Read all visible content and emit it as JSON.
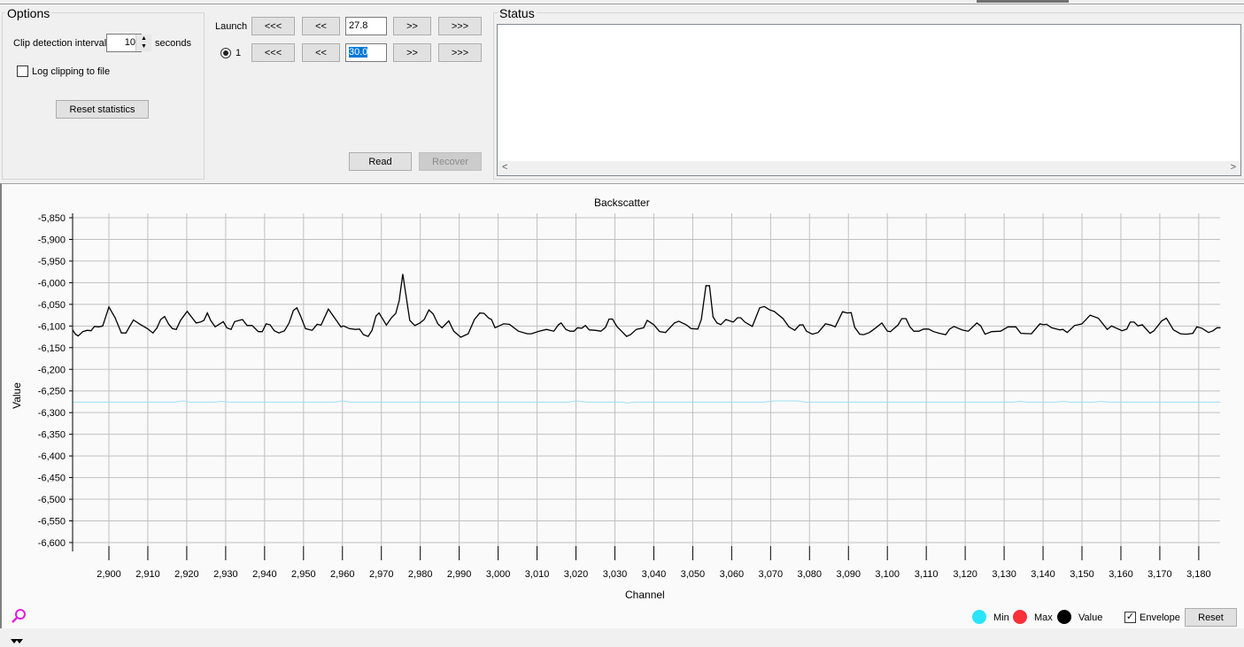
{
  "options": {
    "title": "Options",
    "clip_label": "Clip detection interval",
    "clip_value": "10",
    "clip_unit": "seconds",
    "log_label": "Log clipping to file",
    "log_checked": false,
    "reset_stats": "Reset statistics"
  },
  "nav": {
    "launch_label": "Launch",
    "radio_label": "1",
    "btn_fast_back": "<<<",
    "btn_back": "<<",
    "btn_fwd": ">>",
    "btn_fast_fwd": ">>>",
    "launch_value": "27.8",
    "row2_value": "30.0",
    "read": "Read",
    "recover": "Recover"
  },
  "status": {
    "title": "Status",
    "scroll_left": "<",
    "scroll_right": ">"
  },
  "legend": {
    "min": "Min",
    "max": "Max",
    "value": "Value",
    "envelope": "Envelope",
    "reset": "Reset",
    "colors": {
      "min": "#29e4fb",
      "max": "#fb3039",
      "value": "#000000"
    }
  },
  "chart_data": {
    "type": "line",
    "title": "Backscatter",
    "xlabel": "Channel",
    "ylabel": "Value",
    "xlim": [
      2890.7,
      3185.6
    ],
    "ylim": [
      -6600,
      -5850
    ],
    "grid": true,
    "xticks": [
      "2,900",
      "2,910",
      "2,920",
      "2,930",
      "2,940",
      "2,950",
      "2,960",
      "2,970",
      "2,980",
      "2,990",
      "3,000",
      "3,010",
      "3,020",
      "3,030",
      "3,040",
      "3,050",
      "3,060",
      "3,070",
      "3,080",
      "3,090",
      "3,100",
      "3,110",
      "3,120",
      "3,130",
      "3,140",
      "3,150",
      "3,160",
      "3,170",
      "3,180"
    ],
    "xtick_values": [
      2900,
      2910,
      2920,
      2930,
      2940,
      2950,
      2960,
      2970,
      2980,
      2990,
      3000,
      3010,
      3020,
      3030,
      3040,
      3050,
      3060,
      3070,
      3080,
      3090,
      3100,
      3110,
      3120,
      3130,
      3140,
      3150,
      3160,
      3170,
      3180
    ],
    "yticks": [
      "-5,850",
      "-5,900",
      "-5,950",
      "-6,000",
      "-6,050",
      "-6,100",
      "-6,150",
      "-6,200",
      "-6,250",
      "-6,300",
      "-6,350",
      "-6,400",
      "-6,450",
      "-6,500",
      "-6,550",
      "-6,600"
    ],
    "ytick_values": [
      -5850,
      -5900,
      -5950,
      -6000,
      -6050,
      -6100,
      -6150,
      -6200,
      -6250,
      -6300,
      -6350,
      -6400,
      -6450,
      -6500,
      -6550,
      -6600
    ],
    "series": [
      {
        "name": "Value",
        "color": "#000000",
        "points": [
          [
            2890.7,
            -6109
          ],
          [
            2891.4,
            -6119
          ],
          [
            2892.1,
            -6123
          ],
          [
            2893.3,
            -6113
          ],
          [
            2894.4,
            -6110
          ],
          [
            2895.4,
            -6111
          ],
          [
            2896.3,
            -6101
          ],
          [
            2897.4,
            -6102
          ],
          [
            2898.4,
            -6100
          ],
          [
            2900,
            -6056
          ],
          [
            2901.6,
            -6081
          ],
          [
            2903.2,
            -6116
          ],
          [
            2904.4,
            -6116
          ],
          [
            2905.4,
            -6100
          ],
          [
            2906.3,
            -6086
          ],
          [
            2908,
            -6096
          ],
          [
            2909.9,
            -6106
          ],
          [
            2911.3,
            -6116
          ],
          [
            2912.3,
            -6105
          ],
          [
            2913.3,
            -6085
          ],
          [
            2914.3,
            -6078
          ],
          [
            2915.3,
            -6095
          ],
          [
            2916.3,
            -6106
          ],
          [
            2917.3,
            -6108
          ],
          [
            2918.4,
            -6087
          ],
          [
            2920.1,
            -6066
          ],
          [
            2922.4,
            -6093
          ],
          [
            2923.5,
            -6091
          ],
          [
            2924.4,
            -6087
          ],
          [
            2925.3,
            -6070
          ],
          [
            2926.2,
            -6088
          ],
          [
            2927.3,
            -6102
          ],
          [
            2929.4,
            -6090
          ],
          [
            2930.3,
            -6104
          ],
          [
            2931.4,
            -6108
          ],
          [
            2932.3,
            -6090
          ],
          [
            2934.3,
            -6085
          ],
          [
            2935.5,
            -6099
          ],
          [
            2936.8,
            -6099
          ],
          [
            2938.4,
            -6113
          ],
          [
            2939.4,
            -6113
          ],
          [
            2940.4,
            -6095
          ],
          [
            2941.4,
            -6097
          ],
          [
            2942.5,
            -6111
          ],
          [
            2943.7,
            -6116
          ],
          [
            2945.1,
            -6111
          ],
          [
            2946.3,
            -6093
          ],
          [
            2947.4,
            -6064
          ],
          [
            2948.3,
            -6058
          ],
          [
            2949.3,
            -6078
          ],
          [
            2950.5,
            -6106
          ],
          [
            2952.2,
            -6110
          ],
          [
            2953.5,
            -6096
          ],
          [
            2954.5,
            -6098
          ],
          [
            2956.4,
            -6061
          ],
          [
            2959.6,
            -6102
          ],
          [
            2960.3,
            -6100
          ],
          [
            2961.8,
            -6106
          ],
          [
            2963.3,
            -6108
          ],
          [
            2964.4,
            -6107
          ],
          [
            2965.4,
            -6120
          ],
          [
            2966.6,
            -6124
          ],
          [
            2967.6,
            -6110
          ],
          [
            2968.6,
            -6077
          ],
          [
            2969.4,
            -6070
          ],
          [
            2971.3,
            -6098
          ],
          [
            2972.6,
            -6081
          ],
          [
            2973.7,
            -6071
          ],
          [
            2974.6,
            -6041
          ],
          [
            2975.5,
            -5980
          ],
          [
            2977.3,
            -6087
          ],
          [
            2978.6,
            -6099
          ],
          [
            2979.9,
            -6093
          ],
          [
            2981,
            -6085
          ],
          [
            2982.2,
            -6063
          ],
          [
            2983.3,
            -6072
          ],
          [
            2984.5,
            -6095
          ],
          [
            2985.6,
            -6104
          ],
          [
            2987.3,
            -6088
          ],
          [
            2988.6,
            -6112
          ],
          [
            2990.4,
            -6126
          ],
          [
            2992.3,
            -6118
          ],
          [
            2993.9,
            -6085
          ],
          [
            2995.3,
            -6070
          ],
          [
            2996.4,
            -6071
          ],
          [
            2997.6,
            -6082
          ],
          [
            2998.3,
            -6085
          ],
          [
            2999.2,
            -6104
          ],
          [
            3001.4,
            -6095
          ],
          [
            3002.9,
            -6096
          ],
          [
            3005.2,
            -6112
          ],
          [
            3007.5,
            -6118
          ],
          [
            3008.5,
            -6118
          ],
          [
            3010.5,
            -6112
          ],
          [
            3012.4,
            -6108
          ],
          [
            3014.3,
            -6112
          ],
          [
            3015.5,
            -6097
          ],
          [
            3016.2,
            -6093
          ],
          [
            3017.4,
            -6108
          ],
          [
            3018.5,
            -6112
          ],
          [
            3019.5,
            -6112
          ],
          [
            3020.4,
            -6104
          ],
          [
            3021.5,
            -6105
          ],
          [
            3022.4,
            -6099
          ],
          [
            3023.4,
            -6109
          ],
          [
            3024.9,
            -6110
          ],
          [
            3026.4,
            -6112
          ],
          [
            3027.6,
            -6103
          ],
          [
            3028.5,
            -6084
          ],
          [
            3029.4,
            -6084
          ],
          [
            3030.5,
            -6101
          ],
          [
            3031.7,
            -6112
          ],
          [
            3033,
            -6124
          ],
          [
            3034,
            -6120
          ],
          [
            3035.5,
            -6108
          ],
          [
            3037.4,
            -6104
          ],
          [
            3038.3,
            -6087
          ],
          [
            3040,
            -6097
          ],
          [
            3041.5,
            -6113
          ],
          [
            3043,
            -6115
          ],
          [
            3045.3,
            -6093
          ],
          [
            3046.4,
            -6089
          ],
          [
            3048.3,
            -6097
          ],
          [
            3049.6,
            -6106
          ],
          [
            3051.3,
            -6107
          ],
          [
            3052.2,
            -6085
          ],
          [
            3053.4,
            -6007
          ],
          [
            3054.3,
            -6007
          ],
          [
            3055.2,
            -6079
          ],
          [
            3056.2,
            -6093
          ],
          [
            3057.2,
            -6097
          ],
          [
            3058.5,
            -6085
          ],
          [
            3060.4,
            -6091
          ],
          [
            3061.5,
            -6081
          ],
          [
            3062.3,
            -6081
          ],
          [
            3063.4,
            -6091
          ],
          [
            3065.3,
            -6101
          ],
          [
            3067.2,
            -6058
          ],
          [
            3068.4,
            -6055
          ],
          [
            3069.8,
            -6063
          ],
          [
            3070.9,
            -6066
          ],
          [
            3073.2,
            -6083
          ],
          [
            3074.7,
            -6102
          ],
          [
            3076.2,
            -6110
          ],
          [
            3077.4,
            -6098
          ],
          [
            3078.3,
            -6097
          ],
          [
            3079.2,
            -6112
          ],
          [
            3080.7,
            -6119
          ],
          [
            3082.2,
            -6115
          ],
          [
            3084.1,
            -6095
          ],
          [
            3085.5,
            -6098
          ],
          [
            3086.6,
            -6102
          ],
          [
            3088.5,
            -6067
          ],
          [
            3089.7,
            -6070
          ],
          [
            3090.7,
            -6069
          ],
          [
            3091.6,
            -6103
          ],
          [
            3092.9,
            -6119
          ],
          [
            3093.9,
            -6120
          ],
          [
            3095.4,
            -6115
          ],
          [
            3096.9,
            -6105
          ],
          [
            3098.6,
            -6093
          ],
          [
            3100,
            -6112
          ],
          [
            3100.8,
            -6113
          ],
          [
            3102.7,
            -6098
          ],
          [
            3103.7,
            -6083
          ],
          [
            3104.8,
            -6083
          ],
          [
            3105.8,
            -6102
          ],
          [
            3106.8,
            -6112
          ],
          [
            3108.1,
            -6112
          ],
          [
            3109.3,
            -6107
          ],
          [
            3110.6,
            -6107
          ],
          [
            3111.9,
            -6113
          ],
          [
            3113.4,
            -6117
          ],
          [
            3115,
            -6120
          ],
          [
            3116,
            -6107
          ],
          [
            3117.1,
            -6101
          ],
          [
            3119.2,
            -6109
          ],
          [
            3120.8,
            -6112
          ],
          [
            3123,
            -6093
          ],
          [
            3124,
            -6100
          ],
          [
            3125.1,
            -6119
          ],
          [
            3126.8,
            -6113
          ],
          [
            3129.1,
            -6112
          ],
          [
            3131,
            -6102
          ],
          [
            3133,
            -6102
          ],
          [
            3134.3,
            -6117
          ],
          [
            3137,
            -6118
          ],
          [
            3139.2,
            -6095
          ],
          [
            3140,
            -6097
          ],
          [
            3140.9,
            -6096
          ],
          [
            3142.2,
            -6104
          ],
          [
            3144.3,
            -6109
          ],
          [
            3145.1,
            -6108
          ],
          [
            3146.2,
            -6115
          ],
          [
            3148.1,
            -6099
          ],
          [
            3150,
            -6095
          ],
          [
            3152.1,
            -6075
          ],
          [
            3154.2,
            -6082
          ],
          [
            3156.5,
            -6108
          ],
          [
            3157.6,
            -6100
          ],
          [
            3160.3,
            -6111
          ],
          [
            3161.5,
            -6107
          ],
          [
            3162.4,
            -6091
          ],
          [
            3163.4,
            -6091
          ],
          [
            3164.4,
            -6100
          ],
          [
            3165.5,
            -6097
          ],
          [
            3167.5,
            -6117
          ],
          [
            3168.5,
            -6111
          ],
          [
            3170.5,
            -6088
          ],
          [
            3171.7,
            -6082
          ],
          [
            3173.5,
            -6109
          ],
          [
            3175.3,
            -6118
          ],
          [
            3176.8,
            -6119
          ],
          [
            3178.5,
            -6117
          ],
          [
            3179.5,
            -6102
          ],
          [
            3180.8,
            -6105
          ],
          [
            3182.5,
            -6115
          ],
          [
            3183.7,
            -6111
          ],
          [
            3184.7,
            -6104
          ],
          [
            3185.6,
            -6104
          ]
        ]
      },
      {
        "name": "Min",
        "color": "#9fdff5",
        "points": [
          [
            2890.7,
            -6276
          ],
          [
            2917,
            -6276
          ],
          [
            2919,
            -6273
          ],
          [
            2921,
            -6276
          ],
          [
            2927,
            -6276
          ],
          [
            2929,
            -6274
          ],
          [
            2931,
            -6276
          ],
          [
            2958,
            -6276
          ],
          [
            2960,
            -6273
          ],
          [
            2962,
            -6276
          ],
          [
            3018,
            -6276
          ],
          [
            3020,
            -6273
          ],
          [
            3023,
            -6276
          ],
          [
            3032,
            -6276
          ],
          [
            3033,
            -6278
          ],
          [
            3035,
            -6276
          ],
          [
            3068,
            -6276
          ],
          [
            3071,
            -6273
          ],
          [
            3077,
            -6273
          ],
          [
            3079,
            -6276
          ],
          [
            3132,
            -6276
          ],
          [
            3134,
            -6274
          ],
          [
            3136,
            -6276
          ],
          [
            3143,
            -6276
          ],
          [
            3145,
            -6274
          ],
          [
            3147,
            -6276
          ],
          [
            3153,
            -6276
          ],
          [
            3155,
            -6274
          ],
          [
            3157,
            -6276
          ],
          [
            3185.6,
            -6276
          ]
        ]
      }
    ]
  }
}
